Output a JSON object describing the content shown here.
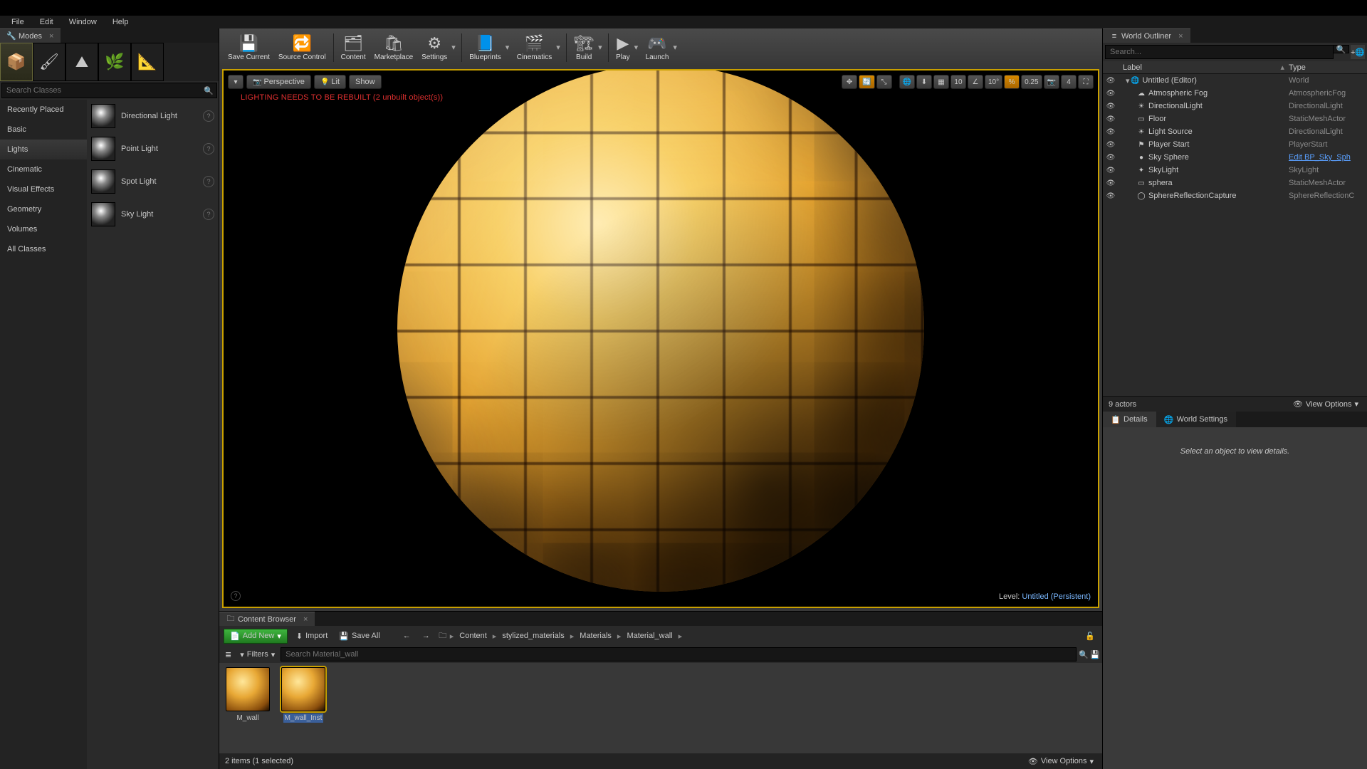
{
  "menu": {
    "file": "File",
    "edit": "Edit",
    "window": "Window",
    "help": "Help"
  },
  "modes": {
    "tab": "Modes",
    "search_ph": "Search Classes",
    "categories": [
      "Recently Placed",
      "Basic",
      "Lights",
      "Cinematic",
      "Visual Effects",
      "Geometry",
      "Volumes",
      "All Classes"
    ],
    "cat_selected": 2,
    "lights": [
      "Directional Light",
      "Point Light",
      "Spot Light",
      "Sky Light"
    ]
  },
  "toolbar": {
    "save": "Save Current",
    "source": "Source Control",
    "content": "Content",
    "market": "Marketplace",
    "settings": "Settings",
    "blueprints": "Blueprints",
    "cinematics": "Cinematics",
    "build": "Build",
    "play": "Play",
    "launch": "Launch"
  },
  "viewport": {
    "perspective": "Perspective",
    "lit": "Lit",
    "show": "Show",
    "warn": "LIGHTING NEEDS TO BE REBUILT (2 unbuilt object(s))",
    "snap_t": "10",
    "snap_r": "10°",
    "snap_s": "0.25",
    "cam": "4",
    "level_pre": "Level:",
    "level": "Untitled (Persistent)"
  },
  "outliner": {
    "tab": "World Outliner",
    "search_ph": "Search...",
    "col_label": "Label",
    "col_type": "Type",
    "rows": [
      {
        "indent": 0,
        "name": "Untitled (Editor)",
        "type": "World",
        "link": false,
        "icon": "🌐"
      },
      {
        "indent": 1,
        "name": "Atmospheric Fog",
        "type": "AtmosphericFog",
        "link": false,
        "icon": "☁"
      },
      {
        "indent": 1,
        "name": "DirectionalLight",
        "type": "DirectionalLight",
        "link": false,
        "icon": "☀"
      },
      {
        "indent": 1,
        "name": "Floor",
        "type": "StaticMeshActor",
        "link": false,
        "icon": "▭"
      },
      {
        "indent": 1,
        "name": "Light Source",
        "type": "DirectionalLight",
        "link": false,
        "icon": "☀"
      },
      {
        "indent": 1,
        "name": "Player Start",
        "type": "PlayerStart",
        "link": false,
        "icon": "⚑"
      },
      {
        "indent": 1,
        "name": "Sky Sphere",
        "type": "Edit BP_Sky_Sph",
        "link": true,
        "icon": "●"
      },
      {
        "indent": 1,
        "name": "SkyLight",
        "type": "SkyLight",
        "link": false,
        "icon": "✦"
      },
      {
        "indent": 1,
        "name": "sphera",
        "type": "StaticMeshActor",
        "link": false,
        "icon": "▭"
      },
      {
        "indent": 1,
        "name": "SphereReflectionCapture",
        "type": "SphereReflectionC",
        "link": false,
        "icon": "◯"
      }
    ],
    "count": "9 actors",
    "view_opts": "View Options"
  },
  "details": {
    "tab1": "Details",
    "tab2": "World Settings",
    "empty": "Select an object to view details."
  },
  "cb": {
    "tab": "Content Browser",
    "add": "Add New",
    "import": "Import",
    "saveall": "Save All",
    "crumbs": [
      "Content",
      "stylized_materials",
      "Materials",
      "Material_wall"
    ],
    "filters": "Filters",
    "search_ph": "Search Material_wall",
    "assets": [
      {
        "name": "M_wall",
        "sel": false
      },
      {
        "name": "M_wall_Inst",
        "sel": true
      }
    ],
    "status": "2 items (1 selected)",
    "view_opts": "View Options"
  }
}
